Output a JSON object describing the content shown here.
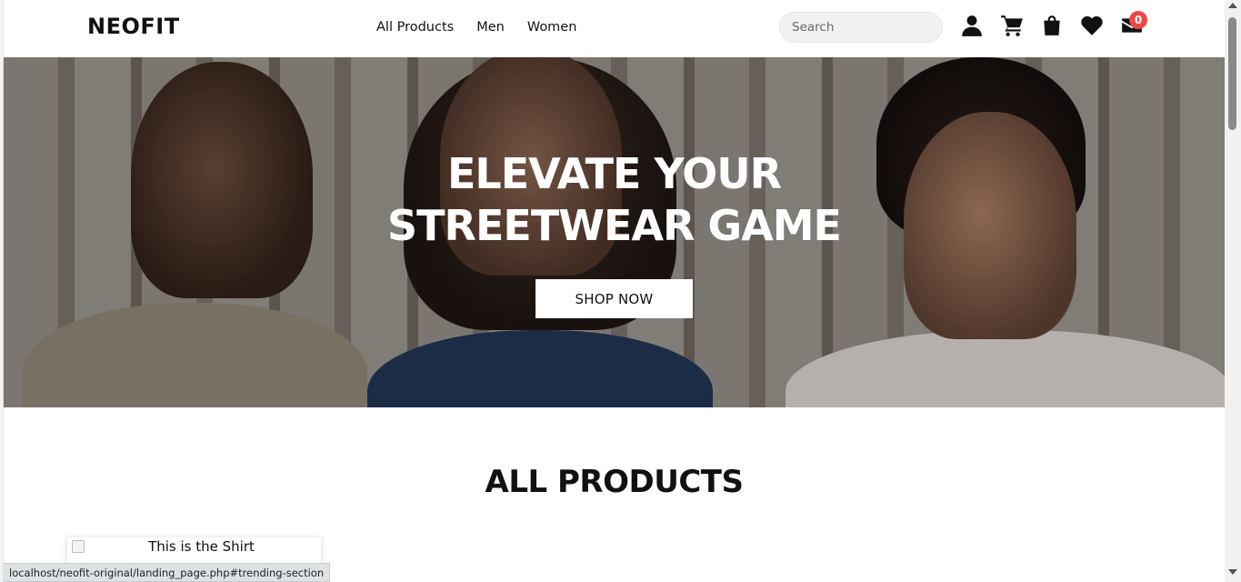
{
  "header": {
    "logo": "NEOFIT",
    "nav": [
      "All Products",
      "Men",
      "Women"
    ],
    "search_placeholder": "Search",
    "icons": [
      "user-icon",
      "cart-icon",
      "shopping-bag-icon",
      "heart-icon",
      "mail-icon"
    ],
    "mail_badge": "0"
  },
  "hero": {
    "title_line1": "ELEVATE YOUR",
    "title_line2": "STREETWEAR GAME",
    "cta": "SHOP NOW"
  },
  "section": {
    "title": "ALL PRODUCTS"
  },
  "product_card": {
    "title": "This is the Shirt"
  },
  "status_bar": {
    "url": "localhost/neofit-original/landing_page.php#trending-section"
  },
  "colors": {
    "badge": "#f04646",
    "text": "#111111",
    "background": "#ffffff"
  }
}
